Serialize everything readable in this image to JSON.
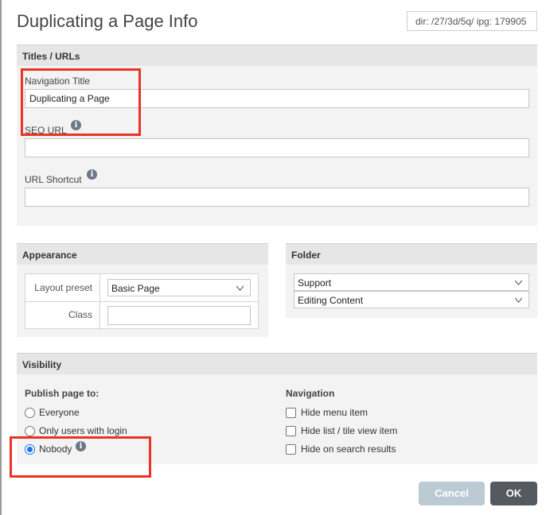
{
  "dialog": {
    "title": "Duplicating a Page Info",
    "dir_info": "dir: /27/3d/5q/   ipg: 179905"
  },
  "titles_urls": {
    "header": "Titles / URLs",
    "navigation_title_label": "Navigation Title",
    "navigation_title_value": "Duplicating a Page",
    "seo_url_label": "SEO URL",
    "seo_url_value": "",
    "url_shortcut_label": "URL Shortcut",
    "url_shortcut_value": ""
  },
  "appearance": {
    "header": "Appearance",
    "layout_preset_label": "Layout preset",
    "layout_preset_value": "Basic Page",
    "class_label": "Class",
    "class_value": ""
  },
  "folder": {
    "header": "Folder",
    "primary_value": "Support",
    "secondary_value": "Editing Content"
  },
  "visibility": {
    "header": "Visibility",
    "publish_label": "Publish page to:",
    "publish_options": [
      {
        "label": "Everyone",
        "checked": false
      },
      {
        "label": "Only users with login",
        "checked": false
      },
      {
        "label": "Nobody",
        "checked": true
      }
    ],
    "navigation_label": "Navigation",
    "navigation_options": [
      {
        "label": "Hide menu item",
        "checked": false
      },
      {
        "label": "Hide list / tile view item",
        "checked": false
      },
      {
        "label": "Hide on search results",
        "checked": false
      }
    ]
  },
  "buttons": {
    "cancel": "Cancel",
    "ok": "OK"
  },
  "icons": {
    "info": "i"
  },
  "colors": {
    "highlight": "#ea3323",
    "radio_selected": "#1a73e8",
    "cancel_bg": "#bccad4",
    "ok_bg": "#555a60"
  }
}
